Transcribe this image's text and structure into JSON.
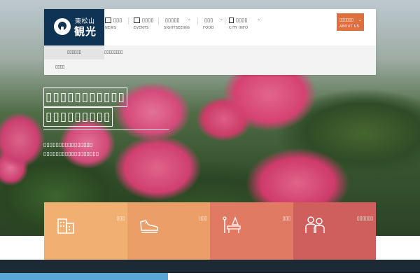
{
  "logo": {
    "sub": "東松山",
    "main": "観光"
  },
  "nav": [
    {
      "label": "▯▯▯",
      "sub": "NEWS",
      "caret": ""
    },
    {
      "label": "▯▯▯▯",
      "sub": "EVENTS",
      "caret": ""
    },
    {
      "label": "▯▯▯▯▯",
      "sub": "SIGHTSEEING",
      "caret": "⌄"
    },
    {
      "label": "▯▯▯",
      "sub": "FOOD",
      "caret": "⌄"
    },
    {
      "label": "▯▯▯▯",
      "sub": "CITY INFO",
      "caret": "⌄"
    }
  ],
  "about": {
    "label": "▯▯▯▯▯▯",
    "sub": "ABOUT US",
    "caret": "⌄"
  },
  "subnav": [
    {
      "label": "▯▯▯▯▯▯"
    },
    {
      "label": "▯▯▯▯▯▯▯▯"
    },
    {
      "label": "▯▯▯▯"
    }
  ],
  "hero": {
    "title_line1": "▯▯▯▯▯▯▯▯▯▯▯",
    "title_line2": "▯▯▯▯▯▯▯▯▯",
    "desc_line1": "▯▯▯▯▯▯▯▯▯▯▯▯▯▯▯▯",
    "desc_line2": "▯▯▯▯▯▯▯▯▯▯▯▯▯▯▯▯▯▯"
  },
  "categories": [
    {
      "label": "▯▯▯",
      "icon": "building-icon",
      "color": "#f1b071"
    },
    {
      "label": "▯▯▯",
      "icon": "shoe-icon",
      "color": "#ec9e69"
    },
    {
      "label": "▯▯▯",
      "icon": "bench-icon",
      "color": "#e17a62"
    },
    {
      "label": "▯▯▯▯▯▯",
      "icon": "family-icon",
      "color": "#cf5f5c"
    }
  ],
  "colors": {
    "header_logo": "#0f3453",
    "about_button": "#de6f3e",
    "bottom_band": "#1c2a36"
  }
}
